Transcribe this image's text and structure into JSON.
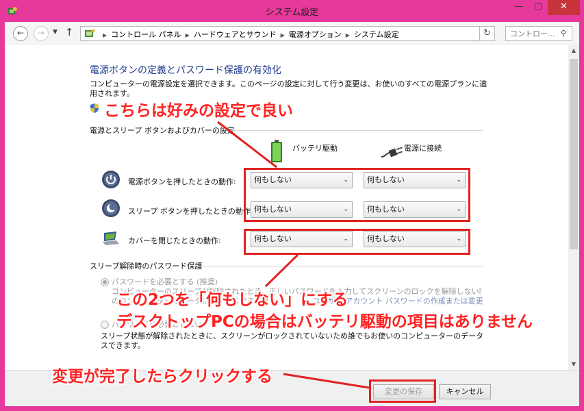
{
  "window": {
    "title": "システム設定",
    "minimize": "—",
    "maximize": "▢",
    "close": "✕"
  },
  "address": {
    "back": "←",
    "forward": "→",
    "up": "↑",
    "breadcrumbs": [
      "コントロール パネル",
      "ハードウェアとサウンド",
      "電源オプション",
      "システム設定"
    ],
    "search_placeholder": "コントロー...",
    "refresh": "↻"
  },
  "page": {
    "heading": "電源ボタンの定義とパスワード保護の有効化",
    "description": "コンピューターの電源設定を選択できます。このページの設定に対して行う変更は、お使いのすべての電源プランに適用されます。",
    "section_buttons": "電源とスリープ ボタンおよびカバーの設定",
    "col_battery": "バッテリ駆動",
    "col_plugged": "電源に接続",
    "rows": [
      {
        "label": "電源ボタンを押したときの動作:",
        "battery": "何もしない",
        "plugged": "何もしない"
      },
      {
        "label": "スリープ ボタンを押したときの動作:",
        "battery": "何もしない",
        "plugged": "何もしない"
      },
      {
        "label": "カバーを閉じたときの動作:",
        "battery": "何もしない",
        "plugged": "何もしない"
      }
    ],
    "section_password": "スリープ解除時のパスワード保護",
    "radio_require": "パスワードを必要とする (推奨)",
    "radio_require_desc_1": "コンピューターのスリープが解除されたとき、正しいパスワードを入力してスクリーンのロックを解除しない限り、お使い",
    "radio_require_desc_2": "のコンピューターのデータにアクセスできません。",
    "radio_require_link": "ユーザー アカウント パスワードの作成または変更",
    "radio_norequire": "パスワードを必要としない",
    "radio_norequire_desc_1": "スリープ状態が解除されたときに、スクリーンがロックされていないため誰でもお使いのコンピューターのデータにアクセ",
    "radio_norequire_desc_2": "スできます。"
  },
  "footer": {
    "save": "変更の保存",
    "cancel": "キャンセル"
  },
  "annotations": {
    "top": "こちらは好みの設定で良い",
    "middle_1": "この2つを「何もしない」にする",
    "middle_2": "デスクトップPCの場合はバッテリ駆動の項目はありません",
    "bottom": "変更が完了したらクリックする"
  },
  "colors": {
    "frame": "#e6399b",
    "heading": "#1e3c8c",
    "annotation": "#ff2222"
  }
}
